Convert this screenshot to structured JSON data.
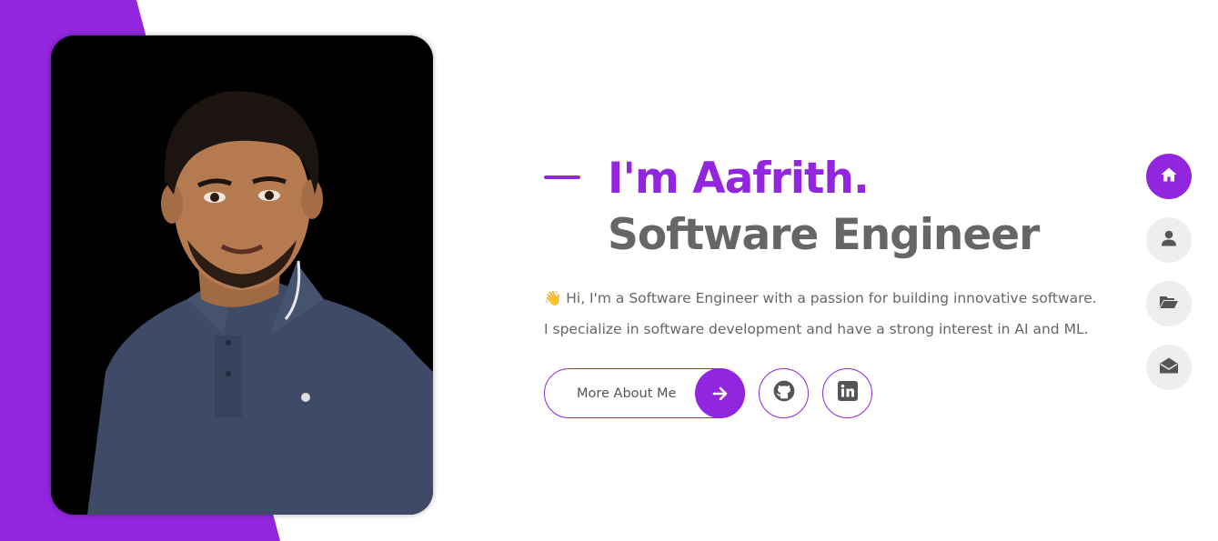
{
  "hero": {
    "greeting": "I'm Aafrith.",
    "role": "Software Engineer",
    "intro_line_1": "👋 Hi, I'm a Software Engineer with a passion for building innovative software.",
    "intro_line_2": "I specialize in software development and have a strong interest in AI and ML."
  },
  "actions": {
    "more_label": "More About Me",
    "arrow_icon": "arrow-right-icon",
    "github_icon": "github-icon",
    "linkedin_icon": "linkedin-icon"
  },
  "side_nav": {
    "items": [
      {
        "icon": "home-icon",
        "active": true
      },
      {
        "icon": "user-icon",
        "active": false
      },
      {
        "icon": "folder-open-icon",
        "active": false
      },
      {
        "icon": "envelope-open-icon",
        "active": false
      }
    ]
  },
  "colors": {
    "accent": "#9226de",
    "heading_gray": "#666666",
    "nav_inactive": "#eeeeee",
    "icon_gray": "#555555"
  }
}
